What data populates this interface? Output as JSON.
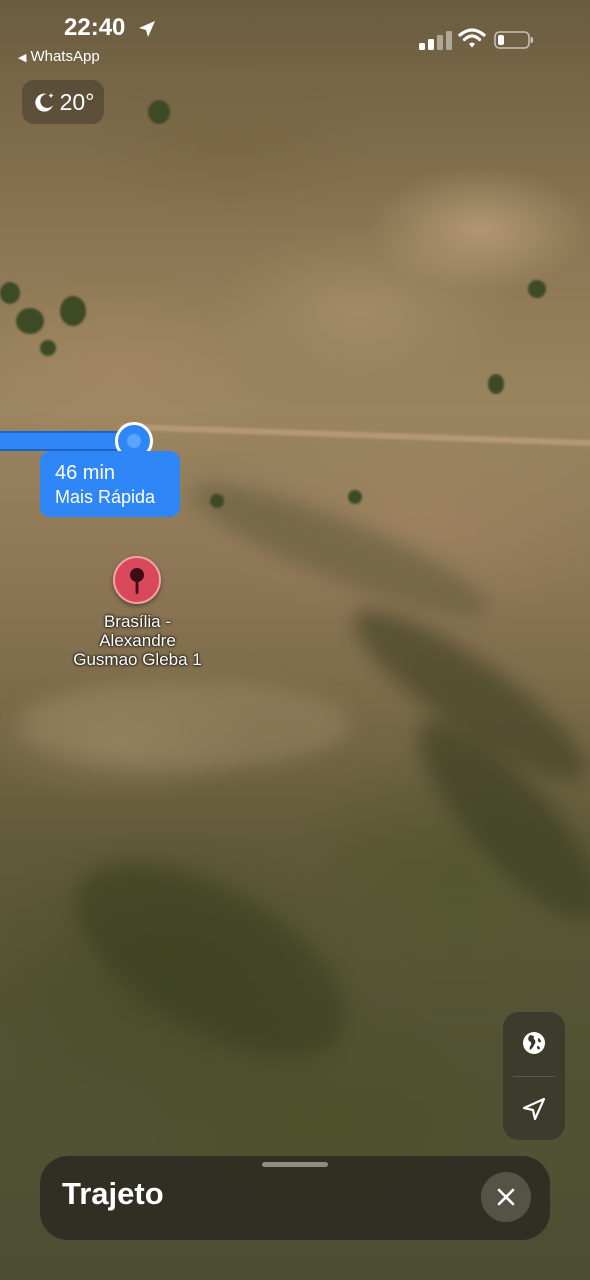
{
  "status_bar": {
    "time": "22:40",
    "back_app": "WhatsApp",
    "back_symbol": "◀",
    "icons": [
      "location-arrow-icon",
      "signal-icon",
      "wifi-icon",
      "battery-icon"
    ]
  },
  "weather": {
    "temperature": "20°",
    "icon": "moon-stars-icon"
  },
  "route": {
    "duration": "46 min",
    "mode": "Mais Rápida",
    "color": "#2f86f6"
  },
  "destination": {
    "label_line1": "Brasília -",
    "label_line2": "Alexandre",
    "label_line3": "Gusmao Gleba 1",
    "pin_color": "#d8485a"
  },
  "map_controls": {
    "icons": [
      "globe-icon",
      "location-arrow-icon"
    ]
  },
  "sheet": {
    "title": "Trajeto",
    "close_icon": "close-icon"
  }
}
